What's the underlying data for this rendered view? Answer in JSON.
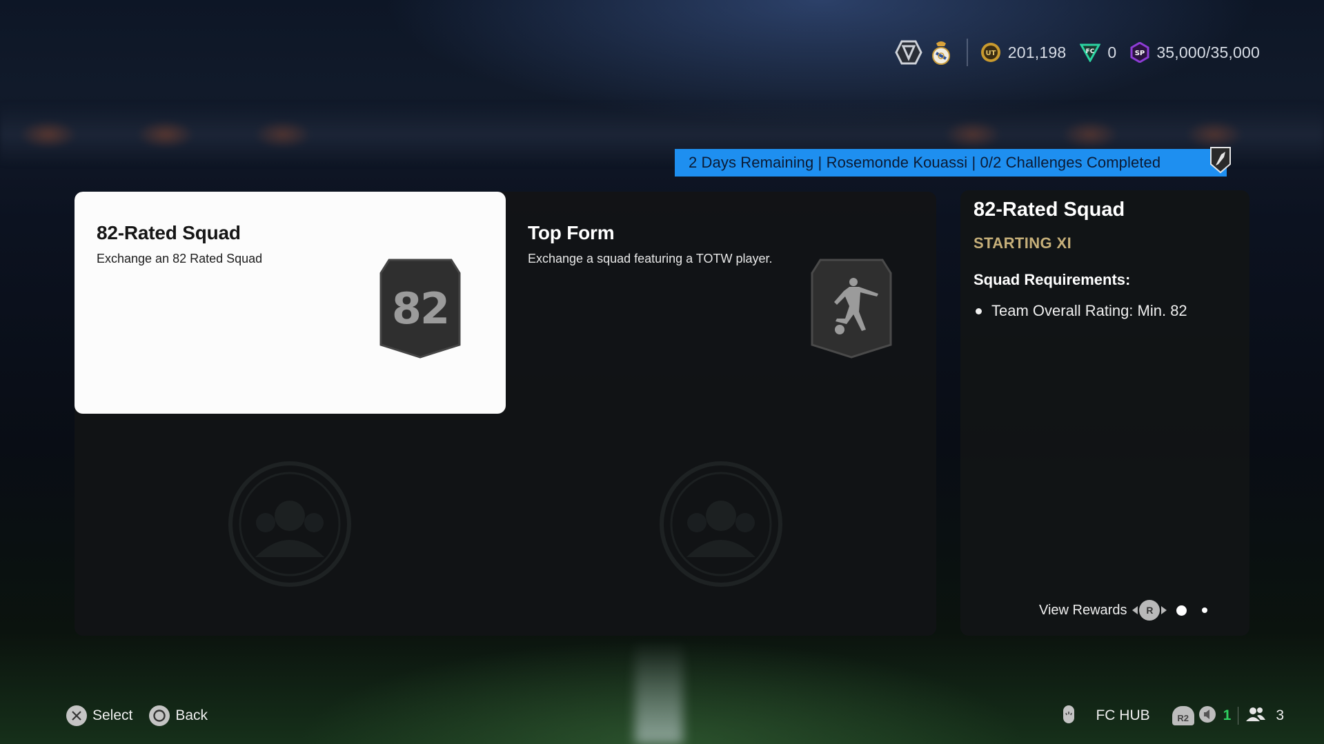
{
  "topbar": {
    "division_icon": "division-rank-icon",
    "club_icon": "club-crest-icon",
    "coins": {
      "icon": "ut-coins-icon",
      "value": "201,198"
    },
    "points": {
      "icon": "fc-points-icon",
      "value": "0"
    },
    "season_points": {
      "icon": "sp-icon",
      "value": "35,000/35,000"
    }
  },
  "banner": {
    "text": "2 Days Remaining | Rosemonde Kouassi | 0/2 Challenges Completed",
    "color": "#1e8ff0",
    "badge_icon": "player-badge-icon"
  },
  "challenges": [
    {
      "title": "82-Rated Squad",
      "description": "Exchange an 82 Rated Squad",
      "badge": "82",
      "selected": true
    },
    {
      "title": "Top Form",
      "description": "Exchange a squad featuring a TOTW player.",
      "badge_icon": "footballer-kick-icon",
      "selected": false
    }
  ],
  "detail": {
    "title": "82-Rated Squad",
    "subtitle": "STARTING XI",
    "subtitle_color": "#c7b07a",
    "requirements_heading": "Squad Requirements:",
    "requirements": [
      "Team Overall Rating: Min. 82"
    ],
    "view_rewards_label": "View Rewards",
    "rewards_button": "R",
    "pages": {
      "current": 1,
      "total": 2
    }
  },
  "bottom": {
    "select_label": "Select",
    "back_label": "Back",
    "hub_label": "FC HUB",
    "r2_label": "R2",
    "notifications_count": "1",
    "friends_count": "3"
  }
}
